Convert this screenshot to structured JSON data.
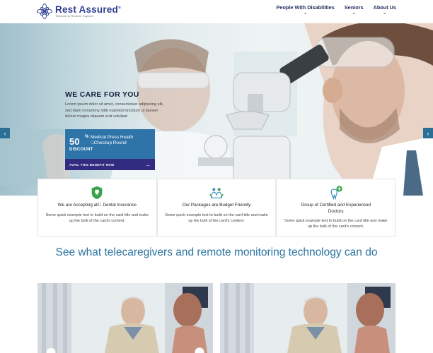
{
  "brand": {
    "name": "Rest Assured",
    "registered": "®",
    "tagline": "Telecare & Remote Support",
    "color": "#2f3d8f"
  },
  "nav": {
    "items": [
      {
        "label": "People With Disabilities",
        "icon": "chevron-down-icon"
      },
      {
        "label": "Seniors",
        "icon": "chevron-down-icon"
      },
      {
        "label": "About Us",
        "icon": "chevron-down-icon"
      }
    ],
    "chevron": "⌄"
  },
  "hero": {
    "title": "WE CARE FOR YOU",
    "body": "Lorem ipsum dolor sit amet, consectetuer adipiscing elit, sed diam nonummy nibh euismod tincidunt ut laoreet dolore magna aliquam erat volutpat.",
    "prev_icon": "‹",
    "next_icon": "›",
    "accent": "#2c6e96"
  },
  "promo": {
    "number": "50",
    "percent": "%",
    "description": "Medical Press Health \u0000Checkup Round",
    "discount": "DISCOUNT",
    "link": "AVAIL THIS BENEFIT NOW",
    "arrow": "→",
    "color": "#2e74a8",
    "bar_color": "#312c80"
  },
  "cards": [
    {
      "icon": "shield-tooth-icon",
      "title": "We are Accepting all\u0000 Dental Insurance",
      "body": "Some quick example text to build on the card title and make up the bulk of the card's content."
    },
    {
      "icon": "hands-people-icon",
      "title": "Our Packages are Budget Friendly",
      "body": "Some quick example text to build on the card title and make up the bulk of the card's content."
    },
    {
      "icon": "tooth-plus-icon",
      "title": "Group of Certified and Experienced Doctors",
      "body": "Some quick example text to build on the card title and make up the bulk of the card's content."
    }
  ],
  "section": {
    "title": "See what telecaregivers and remote monitoring technology can do",
    "color": "#2a73a0"
  }
}
